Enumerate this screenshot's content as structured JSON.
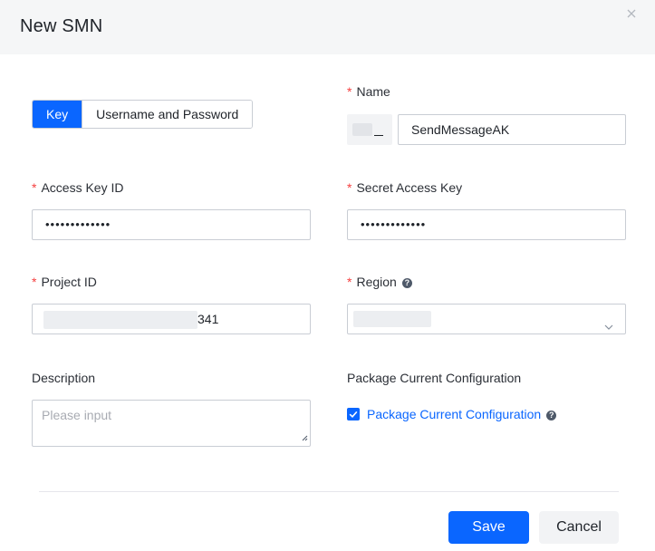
{
  "dialog": {
    "title": "New SMN"
  },
  "auth_tabs": [
    {
      "label": "Key",
      "active": true
    },
    {
      "label": "Username and Password",
      "active": false
    }
  ],
  "fields": {
    "name": {
      "label": "Name",
      "required": true,
      "value": "SendMessageAK"
    },
    "access_key_id": {
      "label": "Access Key ID",
      "required": true,
      "value": "•••••••••••••"
    },
    "secret_access_key": {
      "label": "Secret Access Key",
      "required": true,
      "value": "•••••••••••••"
    },
    "project_id": {
      "label": "Project ID",
      "required": true,
      "value_visible_suffix": "341"
    },
    "region": {
      "label": "Region",
      "required": true
    },
    "description": {
      "label": "Description",
      "placeholder": "Please input"
    },
    "package_config": {
      "label": "Package Current Configuration",
      "checkbox_label": "Package Current Configuration",
      "checked": true
    }
  },
  "required_mark": "*",
  "help_glyph": "?",
  "footer": {
    "save_label": "Save",
    "cancel_label": "Cancel"
  },
  "colors": {
    "primary": "#0a66ff",
    "required": "#f53f3f",
    "header_bg": "#f5f6f7"
  }
}
